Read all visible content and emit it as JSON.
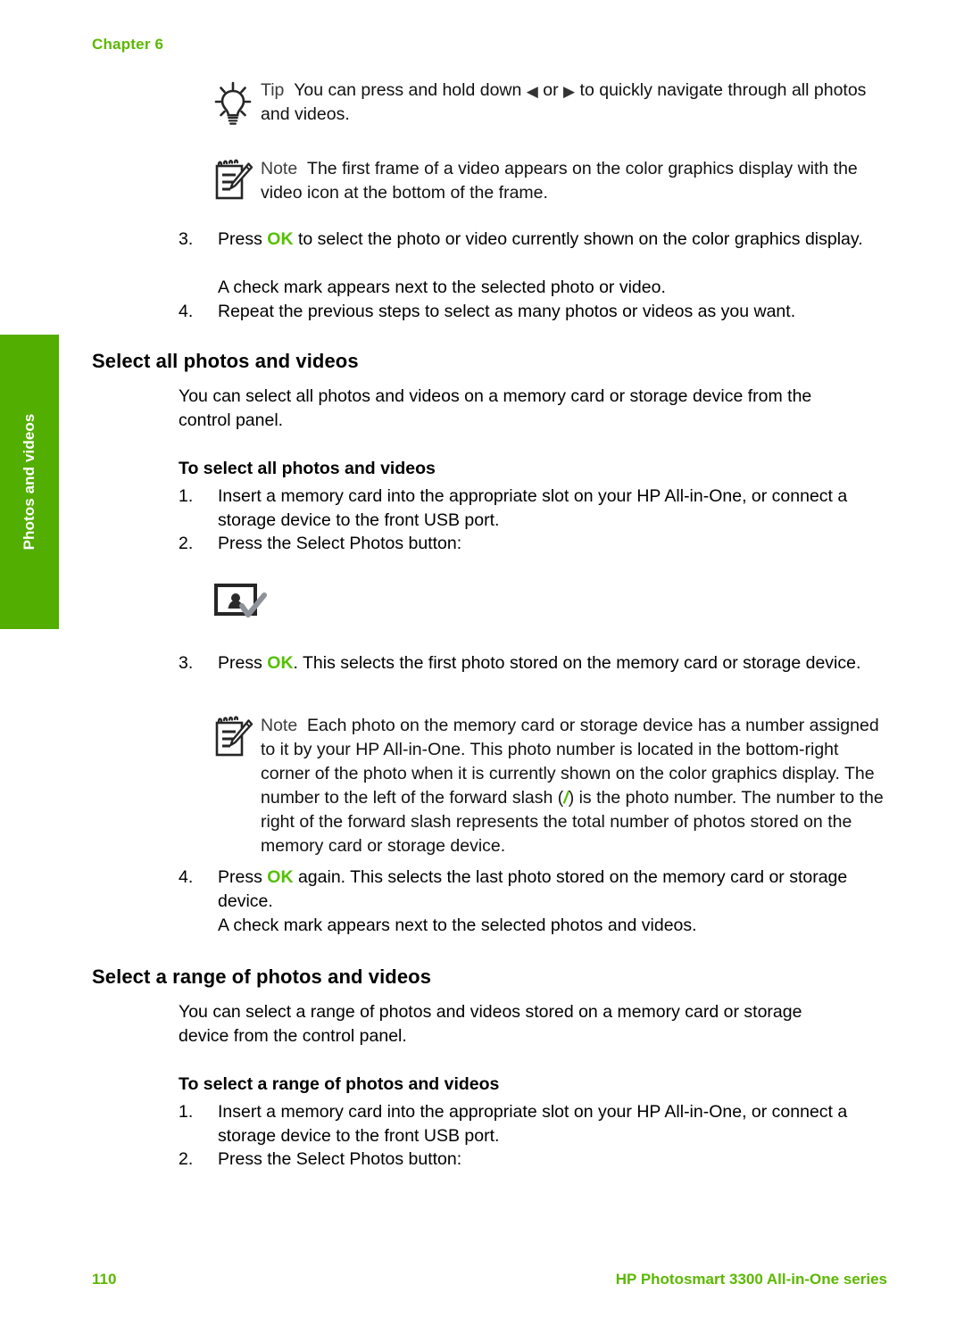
{
  "header": {
    "chapter_label": "Chapter 6"
  },
  "side_tab": {
    "label": "Photos and videos",
    "color": "#52AE00"
  },
  "colors": {
    "brand_green": "#52AE00",
    "text_green": "#55C000",
    "footer_green": "#5BB800",
    "body_text": "#111111"
  },
  "admonitions": {
    "tip1": {
      "keyword": "Tip",
      "icon": "lightbulb-icon",
      "text_before": "You can press and hold down",
      "arrow_left": "◀",
      "text_middle": "or",
      "arrow_right": "▶",
      "text_after": "to quickly navigate through all photos and videos."
    },
    "note1": {
      "keyword": "Note",
      "icon": "notepad-pencil-icon",
      "text": "The first frame of a video appears on the color graphics display with the video icon at the bottom of the frame."
    },
    "note2": {
      "keyword": "Note",
      "icon": "notepad-pencil-icon",
      "text_part1": "Each photo on the memory card or storage device has a number assigned to it by your HP All-in-One. This photo number is located in the bottom-right corner of the photo when it is currently shown on the color graphics display. The number to the left of the forward slash (",
      "slash": "/",
      "text_part2": ") is the photo number. The number to the right of the forward slash represents the total number of photos stored on the memory card or storage device."
    }
  },
  "top_steps": [
    {
      "num": "3.",
      "text_before": "Press",
      "ok": "OK",
      "text_after": "to select the photo or video currently shown on the color graphics display."
    },
    {
      "num": "",
      "text_plain": "A check mark appears next to the selected photo or video."
    },
    {
      "num": "4.",
      "text_plain": "Repeat the previous steps to select as many photos or videos as you want."
    }
  ],
  "section_all": {
    "heading": "Select all photos and videos",
    "intro": "You can select all photos and videos on a memory card or storage device from the control panel.",
    "subheading": "To select all photos and videos",
    "steps": [
      {
        "num": "1.",
        "text": "Insert a memory card into the appropriate slot on your HP All-in-One, or connect a storage device to the front USB port."
      },
      {
        "num": "2.",
        "text": "Press the Select Photos button:"
      }
    ],
    "button_icon": "select-photos-button-icon",
    "step3": {
      "num": "3.",
      "text_before": "Press",
      "ok": "OK",
      "text_after": ". This selects the first photo stored on the memory card or storage device."
    },
    "step4": {
      "num": "4.",
      "text_before": "Press",
      "ok": "OK",
      "text_after": "again. This selects the last photo stored on the memory card or storage device."
    },
    "step4_follow": "A check mark appears next to the selected photos and videos."
  },
  "section_range": {
    "heading": "Select a range of photos and videos",
    "intro": "You can select a range of photos and videos stored on a memory card or storage device from the control panel.",
    "subheading": "To select a range of photos and videos",
    "steps": [
      {
        "num": "1.",
        "text": "Insert a memory card into the appropriate slot on your HP All-in-One, or connect a storage device to the front USB port."
      },
      {
        "num": "2.",
        "text": "Press the Select Photos button:"
      }
    ]
  },
  "footer": {
    "page_number": "110",
    "product_title": "HP Photosmart 3300 All-in-One series"
  }
}
